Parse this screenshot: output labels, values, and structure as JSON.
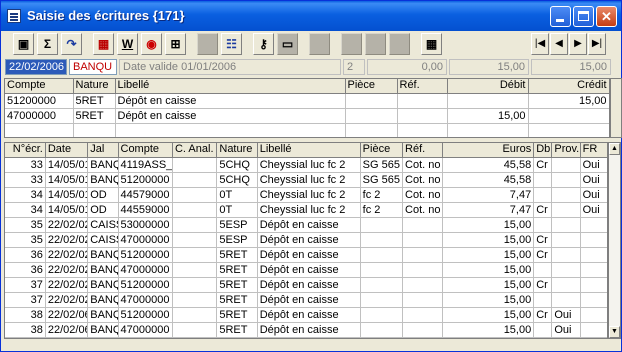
{
  "window": {
    "title": "Saisie des écritures {171}"
  },
  "header": {
    "date": "22/02/2006",
    "journal": "BANQU",
    "libelle_placeholder": "Date valide 01/01/2006",
    "piece_count": "2",
    "amount1": "0,00",
    "amount2": "15,00",
    "amount3": "15,00"
  },
  "top_grid": {
    "columns": [
      "Compte",
      "Nature",
      "Libellé",
      "Pièce",
      "Réf.",
      "Débit",
      "Crédit"
    ],
    "rows": [
      [
        "51200000",
        "5RET",
        "Dépôt en caisse",
        "",
        "",
        "",
        "15,00"
      ],
      [
        "47000000",
        "5RET",
        "Dépôt en caisse",
        "",
        "",
        "15,00",
        ""
      ],
      [
        "",
        "",
        "",
        "",
        "",
        "",
        ""
      ]
    ]
  },
  "main_grid": {
    "columns": [
      "N°écr.",
      "Date",
      "Jal",
      "Compte",
      "C. Anal.",
      "Nature",
      "Libellé",
      "Pièce",
      "Réf.",
      "Euros",
      "Db",
      "Prov.",
      "FR"
    ],
    "rows": [
      [
        "33",
        "14/05/01",
        "BANQ",
        "4119ASS_",
        "",
        "5CHQ",
        "Cheyssial luc fc 2",
        "SG 565",
        "Cot. no",
        "45,58",
        "Cr",
        "",
        "Oui"
      ],
      [
        "33",
        "14/05/01",
        "BANQ",
        "51200000",
        "",
        "5CHQ",
        "Cheyssial luc fc 2",
        "SG 565",
        "Cot. no",
        "45,58",
        "",
        "",
        "Oui"
      ],
      [
        "34",
        "14/05/01",
        "OD",
        "44579000",
        "",
        "0T",
        "Cheyssial luc fc 2",
        "fc 2",
        "Cot. no",
        "7,47",
        "",
        "",
        "Oui"
      ],
      [
        "34",
        "14/05/01",
        "OD",
        "44559000",
        "",
        "0T",
        "Cheyssial luc fc 2",
        "fc 2",
        "Cot. no",
        "7,47",
        "Cr",
        "",
        "Oui"
      ],
      [
        "35",
        "22/02/02",
        "CAISS",
        "53000000",
        "",
        "5ESP",
        "Dépôt en caisse",
        "",
        "",
        "15,00",
        "",
        "",
        ""
      ],
      [
        "35",
        "22/02/02",
        "CAISS",
        "47000000",
        "",
        "5ESP",
        "Dépôt en caisse",
        "",
        "",
        "15,00",
        "Cr",
        "",
        ""
      ],
      [
        "36",
        "22/02/02",
        "BANQ",
        "51200000",
        "",
        "5RET",
        "Dépôt en caisse",
        "",
        "",
        "15,00",
        "Cr",
        "",
        ""
      ],
      [
        "36",
        "22/02/02",
        "BANQ",
        "47000000",
        "",
        "5RET",
        "Dépôt en caisse",
        "",
        "",
        "15,00",
        "",
        "",
        ""
      ],
      [
        "37",
        "22/02/02",
        "BANQ",
        "51200000",
        "",
        "5RET",
        "Dépôt en caisse",
        "",
        "",
        "15,00",
        "Cr",
        "",
        ""
      ],
      [
        "37",
        "22/02/02",
        "BANQ",
        "47000000",
        "",
        "5RET",
        "Dépôt en caisse",
        "",
        "",
        "15,00",
        "",
        "",
        ""
      ],
      [
        "38",
        "22/02/06",
        "BANQ",
        "51200000",
        "",
        "5RET",
        "Dépôt en caisse",
        "",
        "",
        "15,00",
        "Cr",
        "Oui",
        ""
      ],
      [
        "38",
        "22/02/06",
        "BANQ",
        "47000000",
        "",
        "5RET",
        "Dépôt en caisse",
        "",
        "",
        "15,00",
        "",
        "Oui",
        ""
      ]
    ]
  },
  "toolbar": {
    "icons": [
      "save-icon",
      "sigma-icon",
      "redo-icon",
      "grid-icon",
      "word-icon",
      "view-icon",
      "tree-icon",
      "blank-icon",
      "list-icon",
      "key-icon",
      "disk-icon",
      "blank-icon",
      "blank-icon",
      "blank-icon",
      "blank-icon",
      "calculator-icon"
    ],
    "nav": [
      "|◀",
      "◀",
      "▶",
      "▶|"
    ]
  }
}
